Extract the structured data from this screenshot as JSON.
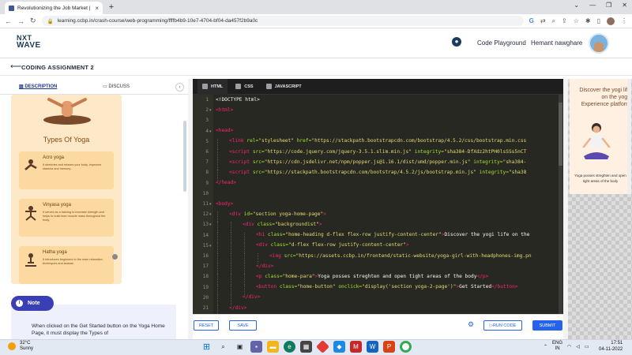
{
  "browser": {
    "tab_title": "Revolutionizing the Job Market |",
    "tab_close": "×",
    "new_tab": "+",
    "url": "learning.ccbp.in/crash-course/web-programming/ffffb4b9-10e7-4704-bf04-da457f2b9a0c",
    "window_controls": [
      "⌄",
      "—",
      "❐",
      "✕"
    ]
  },
  "header": {
    "logo_line1": "NXT",
    "logo_line2": "WAVE",
    "code_playground": "Code Playground",
    "user_name": "Hemant nawghare"
  },
  "assignment": {
    "title": "CODING ASSIGNMENT 2"
  },
  "left_tabs": {
    "description": "DESCRIPTION",
    "discuss": "DISCUSS"
  },
  "yoga_card": {
    "title": "Types Of Yoga",
    "items": [
      {
        "name": "Acro yoga",
        "desc": "It stretches and relaxes your body, improves stamina and memory."
      },
      {
        "name": "Vinyasa yoga",
        "desc": "It serves as a training to increase strength and helps to build lean muscle mass throughout the body."
      },
      {
        "name": "Hatha yoga",
        "desc": "It introduces beginners to the main relaxation techniques and asanas"
      }
    ]
  },
  "note": {
    "label": "Note",
    "text": "When clicked on the Get Started button on the Yoga Home Page, it must display the Types of"
  },
  "editor": {
    "tabs": [
      "HTML",
      "CSS",
      "JAVASCRIPT"
    ],
    "line_numbers": [
      "1",
      "2",
      "3",
      "4",
      "5",
      "6",
      "7",
      "8",
      "9",
      "10",
      "11",
      "12",
      "13",
      "14",
      "15",
      "16",
      "17",
      "18",
      "19",
      "20",
      "21"
    ],
    "reset": "RESET",
    "save": "SAVE",
    "run": "RUN CODE",
    "submit": "SUBMIT"
  },
  "preview": {
    "heading": "Discover the yogi life on the yoga Experience platform",
    "para": "Yoga posses streghten and open tight areas of the body"
  },
  "taskbar": {
    "temp": "32°C",
    "condition": "Sunny",
    "lang1": "ENG",
    "lang2": "IN",
    "time": "17:51",
    "date": "04-11-2022"
  },
  "colors": {
    "accent": "#2563eb",
    "note_badge": "#3b3fb6",
    "card_bg": "#fde8c7",
    "editor_bg": "#272822"
  }
}
